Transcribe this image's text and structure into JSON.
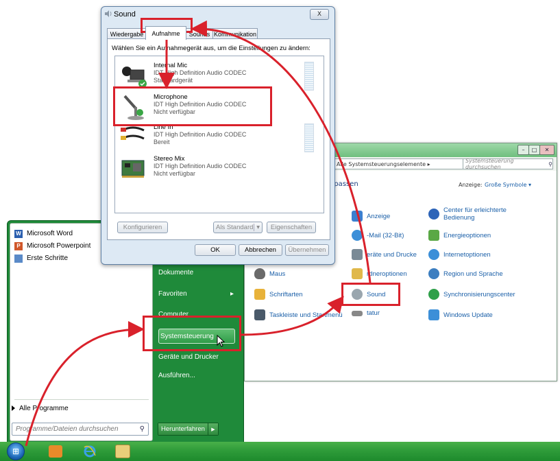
{
  "sound_dialog": {
    "title": "Sound",
    "close": "X",
    "tabs": [
      "Wiedergabe",
      "Aufnahme",
      "Sounds",
      "Kommunikation"
    ],
    "instruction": "Wählen Sie ein Aufnahmegerät aus, um die Einstellungen zu ändern:",
    "devices": [
      {
        "name": "Internal Mic",
        "driver": "IDT High Definition Audio CODEC",
        "status": "Standardgerät"
      },
      {
        "name": "Microphone",
        "driver": "IDT High Definition Audio CODEC",
        "status": "Nicht verfügbar"
      },
      {
        "name": "Line In",
        "driver": "IDT High Definition Audio CODEC",
        "status": "Bereit"
      },
      {
        "name": "Stereo Mix",
        "driver": "IDT High Definition Audio CODEC",
        "status": "Nicht verfügbar"
      }
    ],
    "buttons": {
      "configure": "Konfigurieren",
      "set_default": "Als Standard",
      "properties": "Eigenschaften",
      "ok": "OK",
      "cancel": "Abbrechen",
      "apply": "Übernehmen"
    }
  },
  "control_panel": {
    "address": "Alle Systemsteuerungselemente ▸",
    "search_placeholder": "Systemsteuerung durchsuchen",
    "heading": "npassen",
    "view_label": "Anzeige:",
    "view_value": "Große Symbole ▾",
    "items": [
      {
        "label": "Anzeige",
        "color": "#3b7fd0"
      },
      {
        "label": "Center für erleichterte Bedienung",
        "color": "#2d64b8"
      },
      {
        "label": "-Mail (32-Bit)",
        "color": "#3c8fd8"
      },
      {
        "label": "Energieoptionen",
        "color": "#5aa845"
      },
      {
        "label": "eräte und Drucke",
        "color": "#7a8a96"
      },
      {
        "label": "Internetoptionen",
        "color": "#3c8fd8"
      },
      {
        "label": "Maus",
        "color": "#6a6a6a"
      },
      {
        "label": "rdneroptionen",
        "color": "#e0b84a"
      },
      {
        "label": "Region und Sprache",
        "color": "#3c7ec0"
      },
      {
        "label": "Schriftarten",
        "color": "#e8b23a"
      },
      {
        "label": "Sound",
        "color": "#9aa6ae"
      },
      {
        "label": "Synchronisierungscenter",
        "color": "#2fa04a"
      },
      {
        "label": "Taskleiste und Startmenü",
        "color": "#4a5a6a"
      },
      {
        "label": "tatur",
        "color": "#888888"
      },
      {
        "label": "Windows Update",
        "color": "#3c8fd8"
      }
    ]
  },
  "start_menu": {
    "programs": [
      {
        "label": "Microsoft Word",
        "icon": "W",
        "color": "#2b5faf"
      },
      {
        "label": "Microsoft Powerpoint",
        "icon": "P",
        "color": "#d0572a"
      },
      {
        "label": "Erste Schritte",
        "icon": "",
        "color": "#5a8ac8"
      }
    ],
    "all_programs": "Alle Programme",
    "search_placeholder": "Programme/Dateien durchsuchen",
    "right_items": [
      "Dokumente",
      "Favoriten",
      "Computer",
      "Systemsteuerung",
      "Geräte und Drucker",
      "Ausführen..."
    ],
    "favorites_arrow": "▸",
    "shutdown": "Herunterfahren",
    "shutdown_arrow": "▶"
  },
  "taskbar": {
    "icons": [
      "start-orb",
      "outlook-icon",
      "internet-explorer-icon",
      "explorer-icon"
    ],
    "colors": {
      "taskbar": "#2f9c3a",
      "highlight": "#d9212b"
    }
  }
}
